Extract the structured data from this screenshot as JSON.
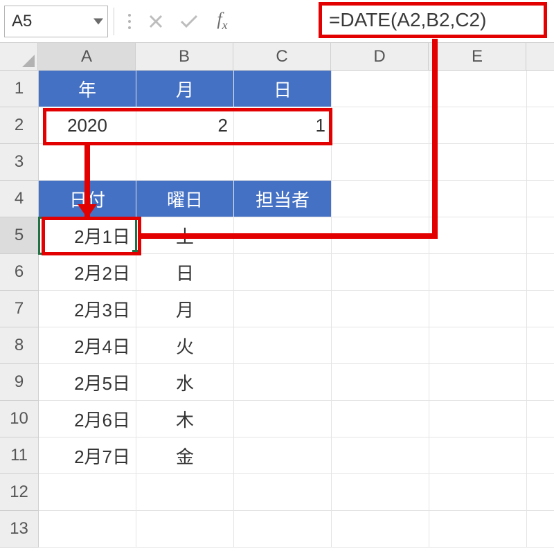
{
  "namebox": {
    "value": "A5"
  },
  "formula": {
    "text": "=DATE(A2,B2,C2)"
  },
  "columns": [
    "A",
    "B",
    "C",
    "D",
    "E"
  ],
  "rows": [
    "1",
    "2",
    "3",
    "4",
    "5",
    "6",
    "7",
    "8",
    "9",
    "10",
    "11",
    "12",
    "13"
  ],
  "header1": {
    "A": "年",
    "B": "月",
    "C": "日"
  },
  "row2": {
    "A": "2020",
    "B": "2",
    "C": "1"
  },
  "header2": {
    "A": "日付",
    "B": "曜日",
    "C": "担当者"
  },
  "dataRows": [
    {
      "date": "2月1日",
      "dow": "土"
    },
    {
      "date": "2月2日",
      "dow": "日"
    },
    {
      "date": "2月3日",
      "dow": "月"
    },
    {
      "date": "2月4日",
      "dow": "火"
    },
    {
      "date": "2月5日",
      "dow": "水"
    },
    {
      "date": "2月6日",
      "dow": "木"
    },
    {
      "date": "2月7日",
      "dow": "金"
    }
  ],
  "colors": {
    "header_bg": "#4471c4",
    "highlight": "#e30000",
    "select": "#1f7246"
  }
}
